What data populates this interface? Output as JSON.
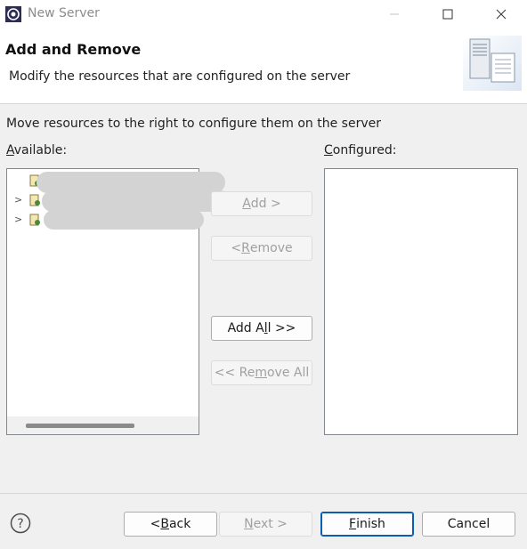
{
  "window": {
    "title": "New Server"
  },
  "header": {
    "title": "Add and Remove",
    "description": "Modify the resources that are configured on the server"
  },
  "content": {
    "instructions": "Move resources to the right to configure them on the server",
    "available_label": {
      "pre": "",
      "mnemonic": "A",
      "post": "vailable:"
    },
    "configured_label": {
      "pre": "",
      "mnemonic": "C",
      "post": "onfigured:"
    },
    "available_items": [
      {
        "expandable": false,
        "name": ""
      },
      {
        "expandable": true,
        "name": ""
      },
      {
        "expandable": true,
        "name": ""
      }
    ],
    "configured_items": []
  },
  "buttons": {
    "add": {
      "pre": "",
      "mnemonic": "A",
      "post": "dd >"
    },
    "remove": {
      "pre": "< ",
      "mnemonic": "R",
      "post": "emove"
    },
    "add_all": {
      "pre": "Add A",
      "mnemonic": "l",
      "post": "l >>"
    },
    "remove_all": {
      "pre": "<< Re",
      "mnemonic": "m",
      "post": "ove All"
    },
    "back": {
      "pre": "< ",
      "mnemonic": "B",
      "post": "ack"
    },
    "next": {
      "pre": "",
      "mnemonic": "N",
      "post": "ext >"
    },
    "finish": {
      "pre": "",
      "mnemonic": "F",
      "post": "inish"
    },
    "cancel": "Cancel"
  },
  "icons": {
    "app": "eclipse-server-icon",
    "help": "question-mark-icon",
    "banner": "server-wizard-banner-icon"
  }
}
